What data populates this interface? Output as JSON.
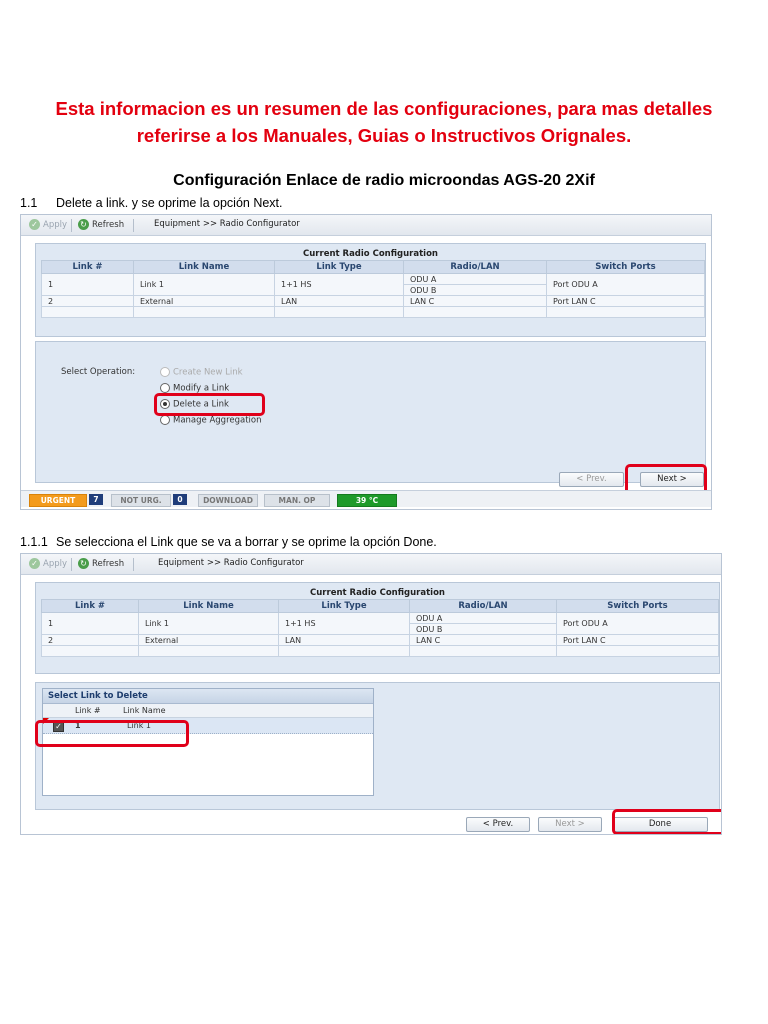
{
  "notice": {
    "line1": "Esta informacion es un resumen de las configuraciones, para mas detalles",
    "line2": "referirse a los Manuales, Guias o Instructivos Orignales."
  },
  "doc_title": "Configuración Enlace de radio microondas AGS-20 2Xif",
  "step1": {
    "num": "1.1",
    "text": "Delete a link. y se oprime la opción Next."
  },
  "step2": {
    "num": "1.1.1",
    "text": "Se selecciona el Link que se va a borrar y se oprime la opción Done."
  },
  "toolbar": {
    "apply": "Apply",
    "refresh": "Refresh",
    "breadcrumb": "Equipment >> Radio Configurator"
  },
  "config_table": {
    "title": "Current Radio Configuration",
    "headers": [
      "Link #",
      "Link Name",
      "Link Type",
      "Radio/LAN",
      "Switch Ports"
    ],
    "row1": {
      "num": "1",
      "name": "Link 1",
      "type": "1+1 HS",
      "radio_a": "ODU A",
      "radio_b": "ODU B",
      "port": "Port ODU A"
    },
    "row2": {
      "num": "2",
      "name": "External",
      "type": "LAN",
      "radio": "LAN C",
      "port": "Port LAN C"
    }
  },
  "operation": {
    "label": "Select Operation:",
    "options": [
      "Create New Link",
      "Modify a Link",
      "Delete a Link",
      "Manage Aggregation"
    ],
    "selected": "Delete a Link"
  },
  "buttons": {
    "prev": "< Prev.",
    "next": "Next >",
    "done": "Done"
  },
  "statusbar": {
    "urgent": "URGENT",
    "urgent_count": "7",
    "not_urg": "NOT URG.",
    "not_urg_count": "0",
    "download": "DOWNLOAD",
    "man_op": "MAN. OP",
    "temperature": "39 °C"
  },
  "select_link": {
    "title": "Select Link to Delete",
    "col_num": "Link #",
    "col_name": "Link Name",
    "row_num": "1",
    "row_name": "Link 1",
    "checked": true
  }
}
